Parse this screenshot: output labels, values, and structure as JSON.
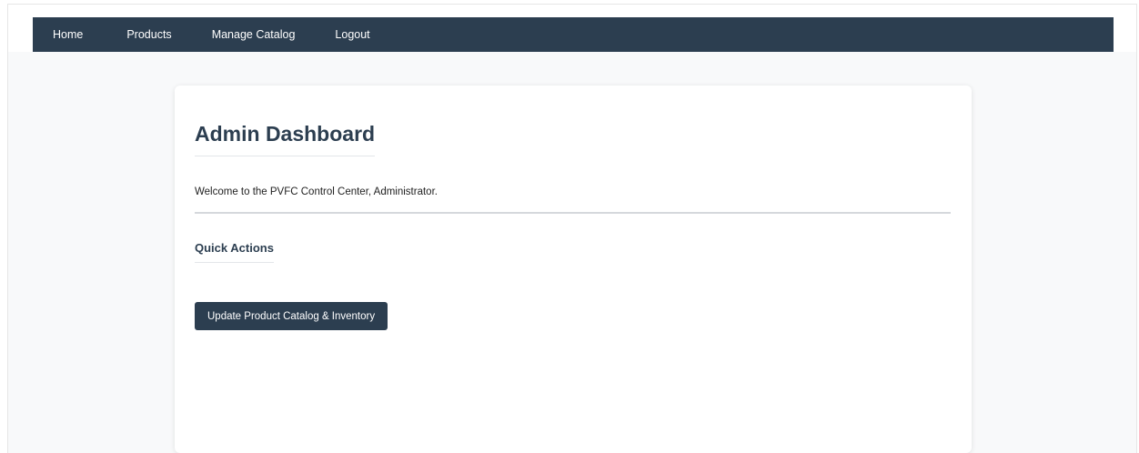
{
  "nav": {
    "items": [
      {
        "label": "Home"
      },
      {
        "label": "Products"
      },
      {
        "label": "Manage Catalog"
      },
      {
        "label": "Logout"
      }
    ]
  },
  "main": {
    "title": "Admin Dashboard",
    "welcome_text": "Welcome to the PVFC Control Center, Administrator.",
    "section_title": "Quick Actions",
    "action_button_label": "Update Product Catalog & Inventory"
  },
  "colors": {
    "navbar_bg": "#2c3e50",
    "heading_text": "#2c3e50",
    "button_bg": "#2c3e50",
    "button_text": "#ffffff",
    "page_bg": "#f8f9fa"
  }
}
